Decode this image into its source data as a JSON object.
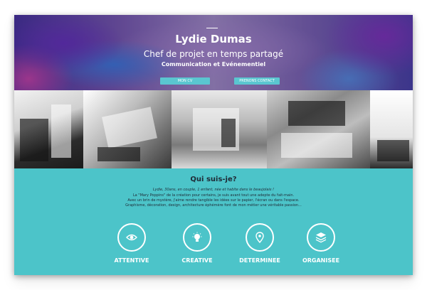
{
  "hero": {
    "name": "Lydie Dumas",
    "subtitle": "Chef de projet en temps partagé",
    "subtitle2": "Communication et Evénementiel",
    "buttons": {
      "cv_label": "MON CV",
      "contact_label": "PRENONS CONTACT"
    }
  },
  "about": {
    "heading": "Qui suis-je?",
    "lines": [
      "Lydie, 30ans, en couple, 1 enfant, née et habite dans le beaujolais  !",
      "La \"Mary Poppins\" de la création pour certains, je suis avant tout une adepte du fait-main.",
      "Avec un brin de mystère, j'aime rendre tangible les idées sur le papier, l'écran ou dans l'espace.",
      "Graphisme, décoration, design, architecture éphémère font de mon métier une véritable passion..."
    ]
  },
  "features": [
    {
      "label": "ATTENTIVE",
      "icon": "eye-icon"
    },
    {
      "label": "CREATIVE",
      "icon": "lightbulb-icon"
    },
    {
      "label": "DETERMINEE",
      "icon": "map-pin-icon"
    },
    {
      "label": "ORGANISEE",
      "icon": "layers-icon"
    }
  ],
  "colors": {
    "accent": "#4cc4c9",
    "button": "#5ac6d0",
    "text_dark": "#1f2a36",
    "hero_purple": "#6a4f9c"
  }
}
